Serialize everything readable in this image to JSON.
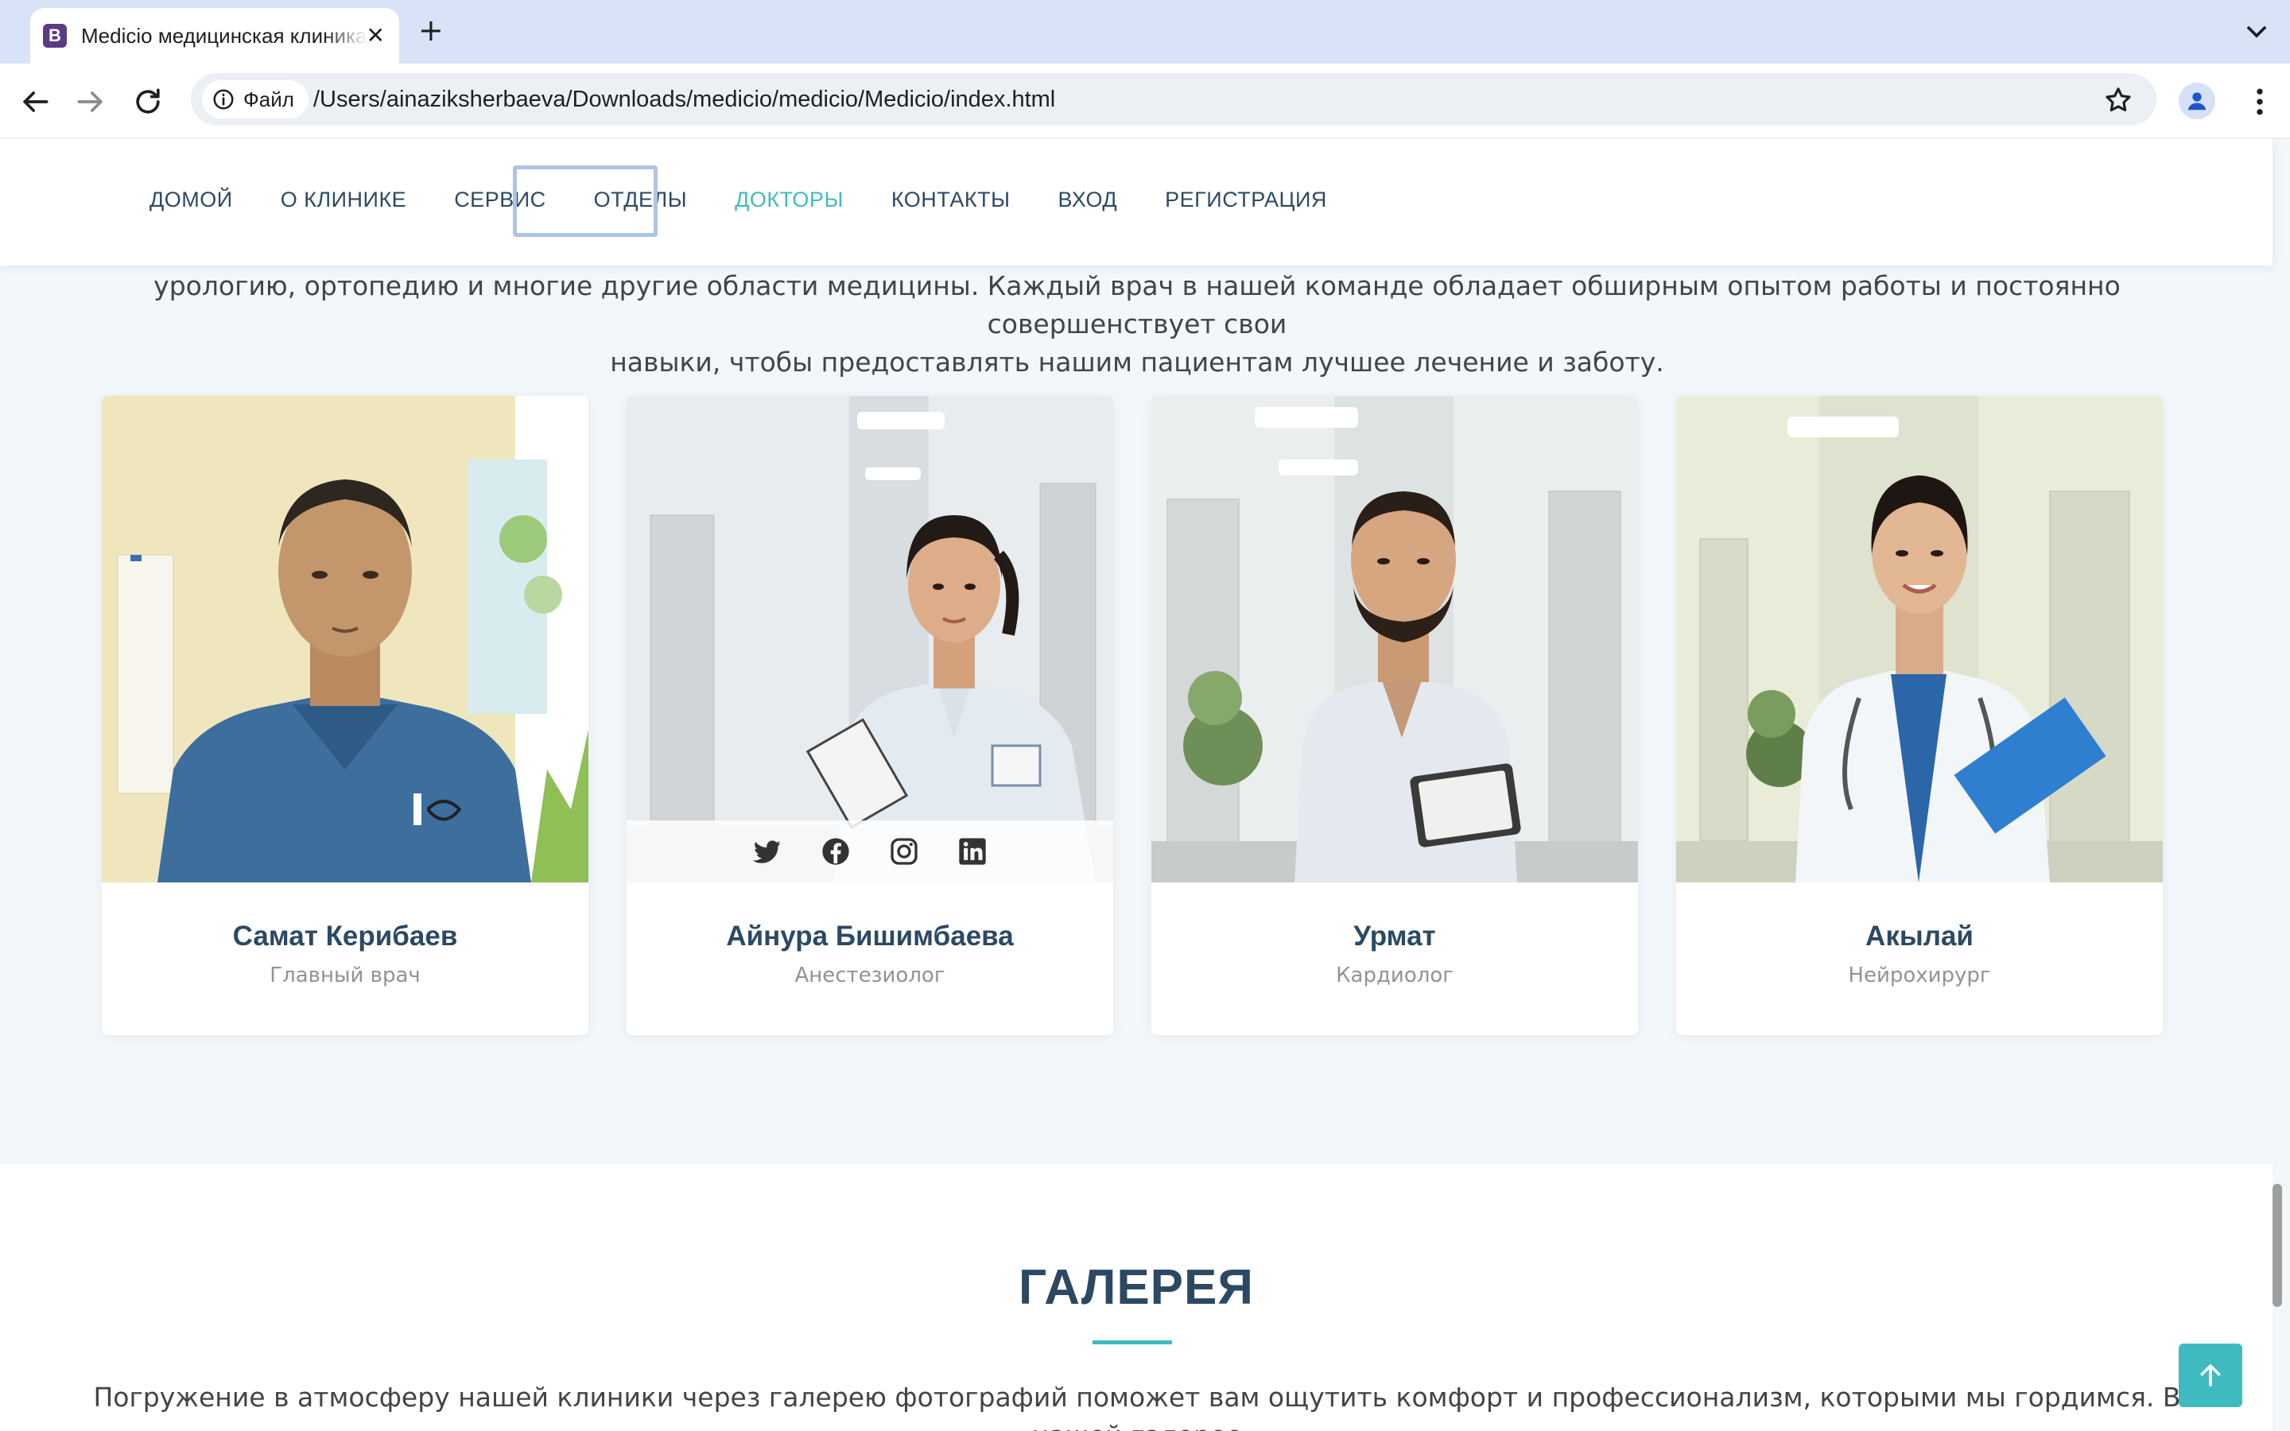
{
  "browser": {
    "tab_title": "Medicio медицинская клиника",
    "favicon_letter": "B",
    "new_tab": "+",
    "close": "✕",
    "site_chip_label": "Файл",
    "url": "/Users/ainaziksherbaeva/Downloads/medicio/medicio/Medicio/index.html"
  },
  "nav": {
    "items": [
      {
        "label": "ДОМОЙ",
        "active": false
      },
      {
        "label": "О КЛИНИКЕ",
        "active": false
      },
      {
        "label": "СЕРВИС",
        "active": false
      },
      {
        "label": "ОТДЕЛЫ",
        "active": false
      },
      {
        "label": "ДОКТОРЫ",
        "active": true
      },
      {
        "label": "КОНТАКТЫ",
        "active": false
      },
      {
        "label": "ВХОД",
        "active": false
      },
      {
        "label": "РЕГИСТРАЦИЯ",
        "active": false
      }
    ]
  },
  "doctors_section": {
    "intro_line1": "урологию, ортопедию и многие другие области медицины. Каждый врач в нашей команде обладает обширным опытом работы и постоянно совершенствует свои",
    "intro_line2": "навыки, чтобы предоставлять нашим пациентам лучшее лечение и заботу.",
    "doctors": [
      {
        "name": "Самат Керибаев",
        "role": "Главный врач"
      },
      {
        "name": "Айнура Бишимбаева",
        "role": "Анестезиолог"
      },
      {
        "name": "Урмат",
        "role": "Кардиолог"
      },
      {
        "name": "Акылай",
        "role": "Нейрохирург"
      }
    ],
    "social_icons": [
      "twitter-icon",
      "facebook-icon",
      "instagram-icon",
      "linkedin-icon"
    ]
  },
  "gallery": {
    "title": "ГАЛЕРЕЯ",
    "text": "Погружение в атмосферу нашей клиники через галерею фотографий поможет вам ощутить комфорт и профессионализм, которыми мы гордимся. В нашей галерее"
  },
  "colors": {
    "accent": "#3fbbc0",
    "heading": "#2c4964",
    "tabstrip": "#d9e3f8"
  }
}
